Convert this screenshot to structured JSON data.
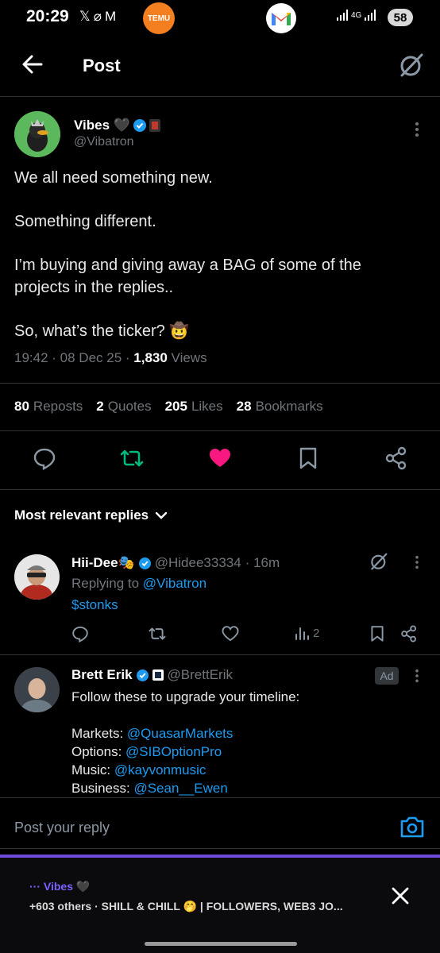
{
  "status_bar": {
    "time": "20:29",
    "left_icons": [
      "x-app-icon",
      "leaf-icon",
      "mail-icon"
    ],
    "temu_label": "TEMU",
    "network_label": "4G",
    "battery": "58"
  },
  "header": {
    "title": "Post"
  },
  "tweet": {
    "display_name": "Vibes 🖤",
    "handle": "@Vibatron",
    "body": [
      "We all need something new.",
      "Something different.",
      "I’m buying and giving away a BAG of some of the projects in the replies..",
      "So, what’s the ticker? 🤠"
    ],
    "time": "19:42",
    "date": "08 Dec 25",
    "views_count": "1,830",
    "views_label": "Views",
    "stats": [
      {
        "num": "80",
        "label": "Reposts"
      },
      {
        "num": "2",
        "label": "Quotes"
      },
      {
        "num": "205",
        "label": "Likes"
      },
      {
        "num": "28",
        "label": "Bookmarks"
      }
    ]
  },
  "replies_filter": "Most relevant replies",
  "reply": {
    "display_name": "Hii-Dee🎭",
    "handle": "@Hidee33334",
    "time": "· 16m",
    "replying_label": "Replying to",
    "replying_to": "@Vibatron",
    "text": "$stonks",
    "views": "2"
  },
  "ad": {
    "display_name": "Brett Erik",
    "handle": "@BrettErik",
    "badge": "Ad",
    "line1": "Follow these to upgrade your timeline:",
    "lines": [
      {
        "label": "Markets:",
        "link": "@QuasarMarkets"
      },
      {
        "label": "Options:",
        "link": "@SIBOptionPro"
      },
      {
        "label": "Music:",
        "link": "@kayvonmusic"
      },
      {
        "label": "Business:",
        "link": "@Sean__Ewen"
      }
    ]
  },
  "composer": {
    "placeholder": "Post your reply"
  },
  "banner": {
    "title": "··· Vibes 🖤",
    "subtitle": "+603 others · SHILL & CHILL 🤭 | FOLLOWERS, WEB3 JO..."
  },
  "colors": {
    "accent": "#1d9bf0",
    "like": "#f91880",
    "repost": "#00ba7c",
    "banner_accent": "#6d4bd8"
  }
}
